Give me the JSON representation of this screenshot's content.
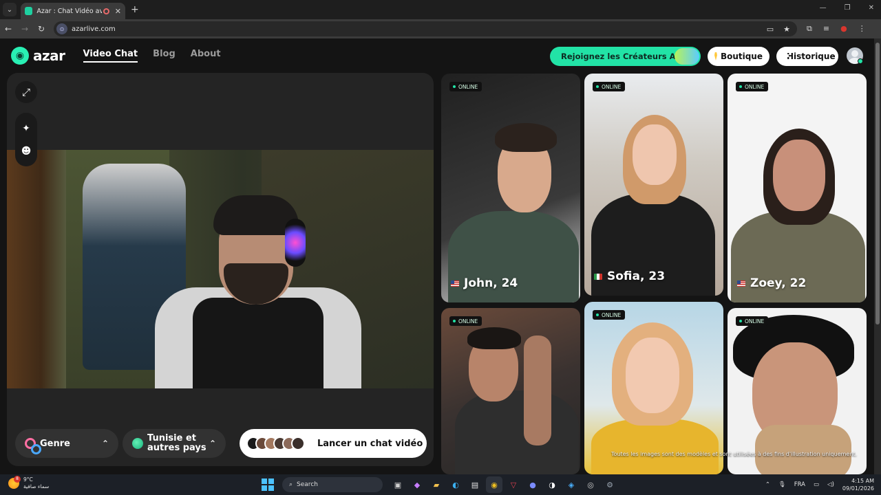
{
  "browser": {
    "tab_title": "Azar : Chat Vidéo avec de n",
    "url": "azarlive.com"
  },
  "header": {
    "logo_text": "azar",
    "nav": [
      "Video Chat",
      "Blog",
      "About"
    ],
    "creator_button": "Rejoignez les Créateurs Azar",
    "shop_button": "Boutique",
    "history_button": "Historique"
  },
  "controls": {
    "gender_label": "Genre",
    "country_line1": "Tunisie et",
    "country_line2": "autres pays",
    "launch_label": "Lancer un chat vidéo"
  },
  "profiles": [
    {
      "status": "ONLINE",
      "name": "John, 24",
      "flag": "us"
    },
    {
      "status": "ONLINE",
      "name": "Sofia, 23",
      "flag": "it"
    },
    {
      "status": "ONLINE",
      "name": "Zoey, 22",
      "flag": "us"
    },
    {
      "status": "ONLINE",
      "name": "",
      "flag": ""
    },
    {
      "status": "ONLINE",
      "name": "",
      "flag": ""
    },
    {
      "status": "ONLINE",
      "name": "",
      "flag": ""
    }
  ],
  "disclaimer": "Toutes les images sont des modèles et sont utilisées à des fins d'illustration uniquement.",
  "taskbar": {
    "weather_badge": "8",
    "temperature": "9°C",
    "weather_desc": "سماء صافية",
    "search_placeholder": "Search",
    "language": "FRA",
    "time": "4:15 AM",
    "date": "09/01/2026"
  },
  "colors": {
    "accent": "#22e3a6",
    "page_bg": "#141414",
    "panel_bg": "#242424"
  }
}
